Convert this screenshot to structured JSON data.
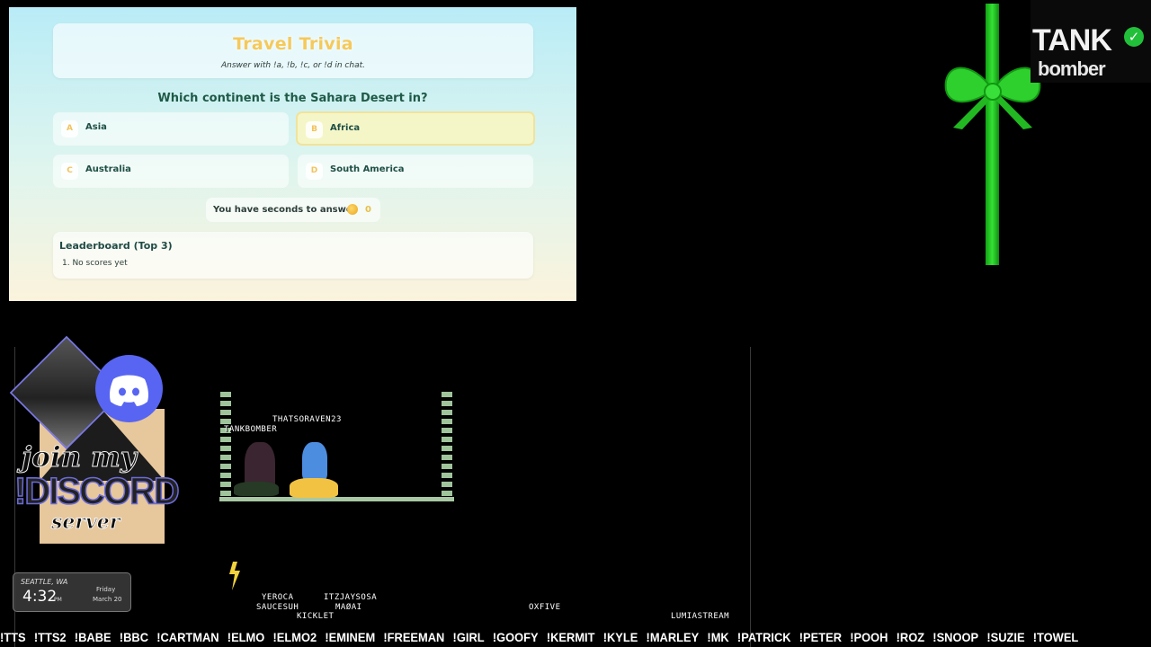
{
  "trivia": {
    "title": "Travel Trivia",
    "subtitle": "Answer with !a, !b, !c, or !d in chat.",
    "question": "Which continent is the Sahara Desert in?",
    "answers": [
      {
        "letter": "A",
        "label": "Asia"
      },
      {
        "letter": "B",
        "label": "Africa"
      },
      {
        "letter": "C",
        "label": "Australia"
      },
      {
        "letter": "D",
        "label": "South America"
      }
    ],
    "timer_text": "You have seconds to answer",
    "timer_value": "0",
    "leaderboard_title": "Leaderboard (Top 3)",
    "leaderboard_entries": [
      "1. No scores yet"
    ]
  },
  "brand": {
    "line1": "TANK",
    "line2": "bomber",
    "verified_glyph": "✓",
    "ribbon_color": "#22c622"
  },
  "discord_panel": {
    "line1": "join my",
    "line2": "!DISCORD",
    "line3": "server",
    "accent_color": "#5865f2"
  },
  "weather": {
    "location": "SEATTLE, WA",
    "time": "4:32",
    "ampm": "PM",
    "day": "Friday",
    "date": "March 20"
  },
  "game": {
    "player_names": [
      "THATSORAVEN23",
      "TANKBOMBER"
    ],
    "bottom_names": [
      "YEROCA",
      "SAUCESUH",
      "KICKLET",
      "ITZJAYSOSA",
      "MAØAI",
      "OXFIVE",
      "LUMIASTREAM"
    ]
  },
  "commands": [
    "!TTS",
    "!TTS2",
    "!BABE",
    "!BBC",
    "!CARTMAN",
    "!ELMO",
    "!ELMO2",
    "!EMINEM",
    "!FREEMAN",
    "!GIRL",
    "!GOOFY",
    "!KERMIT",
    "!KYLE",
    "!MARLEY",
    "!MK",
    "!PATRICK",
    "!PETER",
    "!POOH",
    "!ROZ",
    "!SNOOP",
    "!SUZIE",
    "!TOWEL"
  ]
}
